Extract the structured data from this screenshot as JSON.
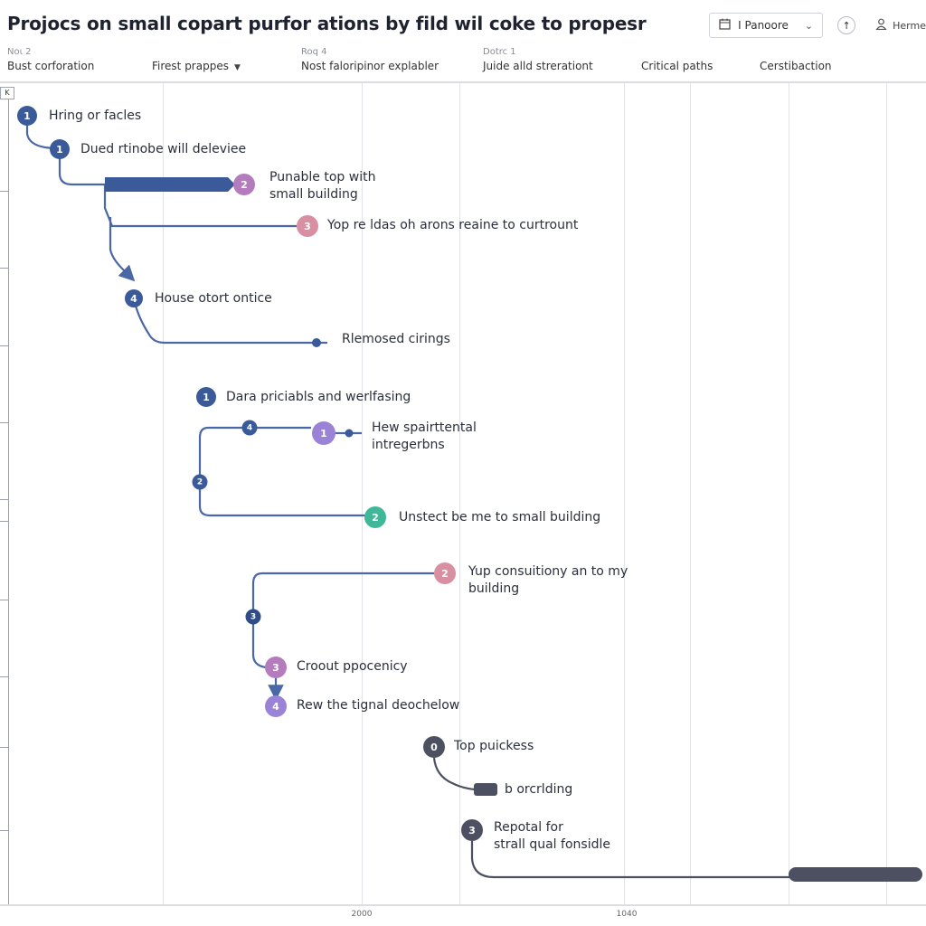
{
  "header": {
    "title": "Projocs on small copart purfor ations by fild wil coke to propesr",
    "view_select": {
      "icon": "calendar-icon",
      "value": "I Panoore",
      "chevron": "chevron-down-icon"
    },
    "upload_icon": "arrow-up-circle-icon",
    "user": {
      "icon": "user-icon",
      "name": "Herme"
    }
  },
  "columns": [
    {
      "sub": "Noι 2",
      "label": "Bust corforation"
    },
    {
      "sub": "",
      "label": "Firest prappes",
      "dropdown": true
    },
    {
      "sub": "Roq 4",
      "label": "Nost faloripinor explabler"
    },
    {
      "sub": "Dotrc 1",
      "label": "Juide alld strerationt"
    },
    {
      "sub": "",
      "label": "Critical paths"
    },
    {
      "sub": "",
      "label": "Cerstibaction"
    }
  ],
  "left_strip": {
    "collapse_label": "K"
  },
  "axis": {
    "ticks": [
      "2000",
      "1040"
    ]
  },
  "colors": {
    "navy": "#3a5a9a",
    "purple_pink": "#b47bbd",
    "pink": "#d88fa2",
    "violet": "#9a82d6",
    "teal": "#3fb89a",
    "slate": "#4d5060",
    "line": "#4a67a6"
  },
  "nodes": [
    {
      "id": "n1",
      "number": "1",
      "color": "navy",
      "label": "Hring or facles"
    },
    {
      "id": "n2",
      "number": "1",
      "color": "navy",
      "label": "Dued rtinobe will deleviee"
    },
    {
      "id": "n3",
      "number": "2",
      "color": "purple_pink",
      "label": "Punable top with\nsmall building"
    },
    {
      "id": "n4",
      "number": "3",
      "color": "pink",
      "label": "Yop re ldas oh arons reaine to curtrount"
    },
    {
      "id": "n5",
      "number": "4",
      "color": "navy",
      "label": "House otort ontice"
    },
    {
      "id": "n6",
      "number": "",
      "color": "navy",
      "label": "Rlemosed cirings"
    },
    {
      "id": "n7",
      "number": "1",
      "color": "navy",
      "label": "Dara priciabls and werlfasing"
    },
    {
      "id": "n8",
      "number": "4",
      "color": "navy",
      "label": ""
    },
    {
      "id": "n9",
      "number": "1",
      "color": "violet",
      "label": "Hew spairttental\nintregerbns"
    },
    {
      "id": "n10",
      "number": "2",
      "color": "navy",
      "label": ""
    },
    {
      "id": "n11",
      "number": "2",
      "color": "teal",
      "label": "Unstect be me to small building"
    },
    {
      "id": "n12",
      "number": "2",
      "color": "pink",
      "label": "Yup consuitiony an to my\nbuilding"
    },
    {
      "id": "n13",
      "number": "3",
      "color": "navy",
      "label": ""
    },
    {
      "id": "n14",
      "number": "3",
      "color": "purple_pink",
      "label": "Croout ppocenicy"
    },
    {
      "id": "n15",
      "number": "4",
      "color": "violet",
      "label": "Rew the tignal deochelow"
    },
    {
      "id": "n16",
      "number": "0",
      "color": "slate",
      "label": "Top puickess"
    },
    {
      "id": "n17",
      "number": "",
      "color": "slate",
      "label": "b orcrlding"
    },
    {
      "id": "n18",
      "number": "3",
      "color": "slate",
      "label": "Repotal for\nstrall qual fonsidle"
    }
  ]
}
